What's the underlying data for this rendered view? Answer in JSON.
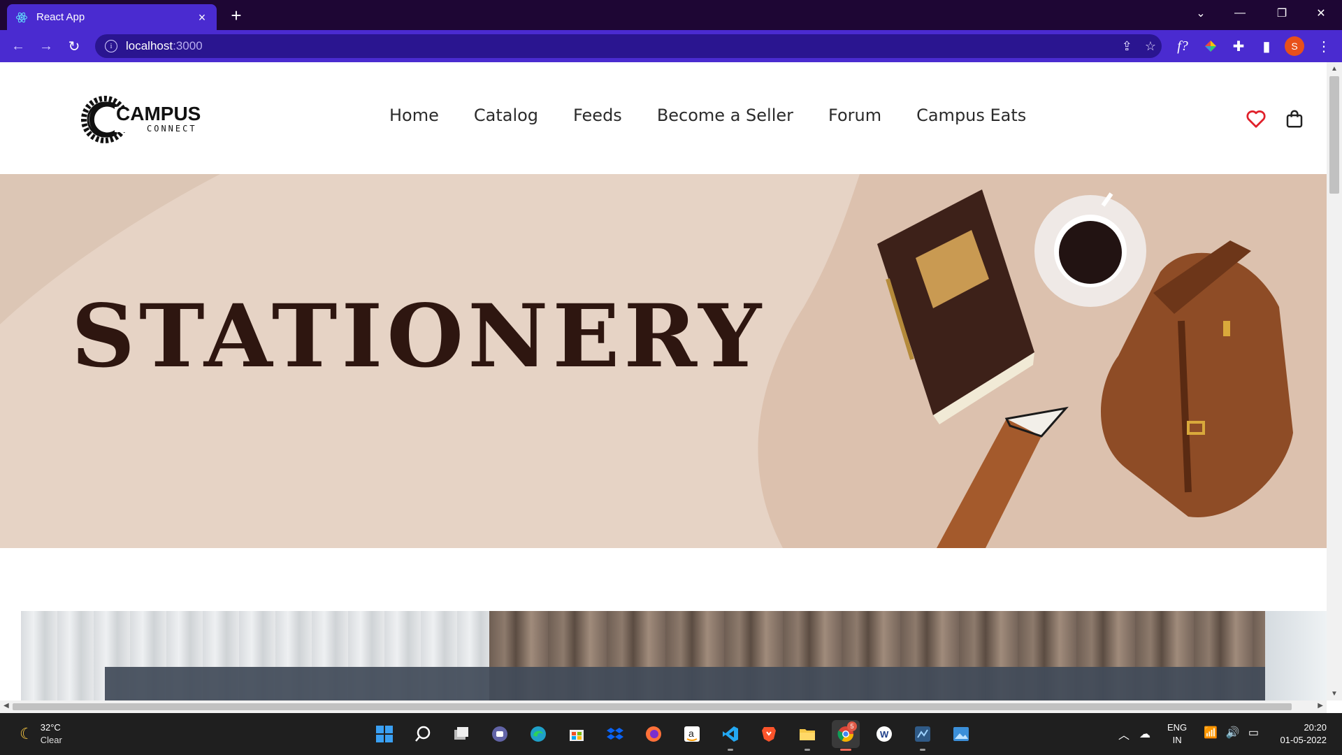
{
  "browser": {
    "tab_title": "React App",
    "url_host": "localhost",
    "url_port": ":3000",
    "profile_initial": "S",
    "accent": "#4a2bd0",
    "frame_color": "#1e0634"
  },
  "site": {
    "logo_main": "CAMPUS",
    "logo_sub": "CONNECT",
    "nav": [
      "Home",
      "Catalog",
      "Feeds",
      "Become a Seller",
      "Forum",
      "Campus Eats"
    ],
    "wishlist_icon": "heart-icon",
    "cart_icon": "shopping-bag-icon"
  },
  "hero": {
    "title": "STATIONERY",
    "background": "#e6d3c5",
    "title_color": "#2e1610",
    "slides_total": 3,
    "active_slide": 1
  },
  "taskbar": {
    "weather_temp": "32°C",
    "weather_cond": "Clear",
    "lang_line1": "ENG",
    "lang_line2": "IN",
    "time": "20:20",
    "date": "01-05-2022",
    "chrome_badge": "5"
  }
}
